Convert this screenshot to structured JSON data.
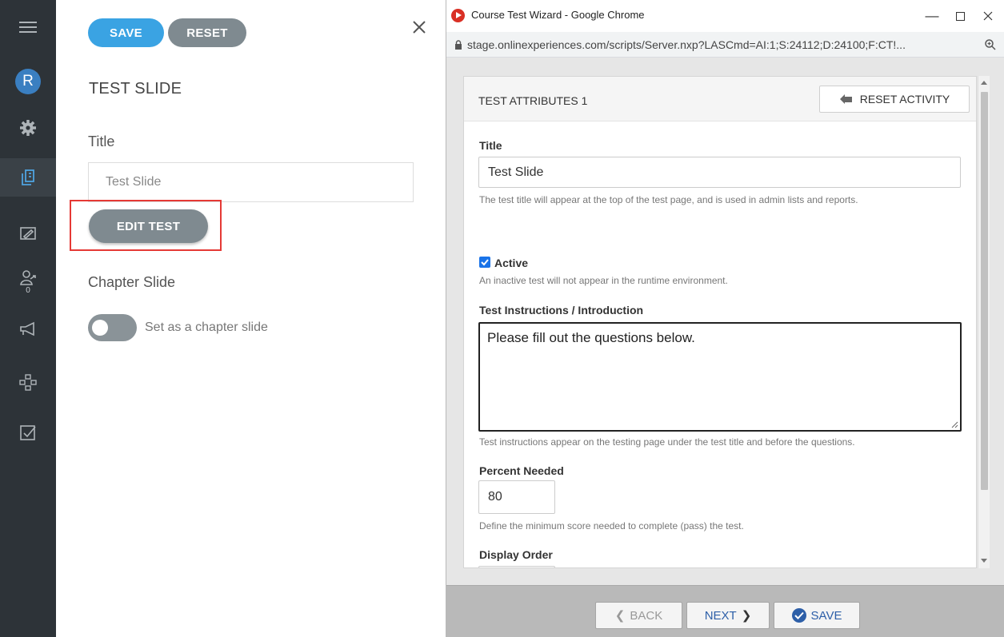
{
  "rail": {
    "avatar_initial": "R",
    "badge_count": "0",
    "icons": [
      "menu-icon",
      "avatar",
      "gear-icon",
      "slides-icon",
      "image-edit-icon",
      "learner-icon",
      "megaphone-icon",
      "sitemap-icon",
      "checkbox-icon"
    ]
  },
  "panel": {
    "save_label": "SAVE",
    "reset_label": "RESET",
    "heading": "TEST SLIDE",
    "title_label": "Title",
    "title_value": "Test Slide",
    "edit_test_label": "EDIT TEST",
    "chapter_label": "Chapter Slide",
    "chapter_toggle_label": "Set as a chapter slide",
    "chapter_toggle_on": false
  },
  "window": {
    "title": "Course Test Wizard - Google Chrome",
    "url": "stage.onlinexperiences.com/scripts/Server.nxp?LASCmd=AI:1;S:24112;D:24100;F:CT!...",
    "card_title": "TEST ATTRIBUTES 1",
    "reset_activity_label": "RESET ACTIVITY",
    "fields": {
      "title_label": "Title",
      "title_value": "Test Slide",
      "title_help": "The test title will appear at the top of the test page, and is used in admin lists and reports.",
      "active_label": "Active",
      "active_checked": true,
      "active_help": "An inactive test will not appear in the runtime environment.",
      "instructions_label": "Test Instructions / Introduction",
      "instructions_value": "Please fill out the questions below.",
      "instructions_help": "Test instructions appear on the testing page under the test title and before the questions.",
      "percent_label": "Percent Needed",
      "percent_value": "80",
      "percent_help": "Define the minimum score needed to complete (pass) the test.",
      "order_label": "Display Order"
    },
    "footer": {
      "back_label": "BACK",
      "next_label": "NEXT",
      "save_label": "SAVE"
    }
  },
  "colors": {
    "rail_bg": "#2d3338",
    "save_blue": "#3aa3e3",
    "grey_button": "#7f8a90",
    "highlight_red": "#e53935",
    "link_blue": "#2d5fa8"
  }
}
